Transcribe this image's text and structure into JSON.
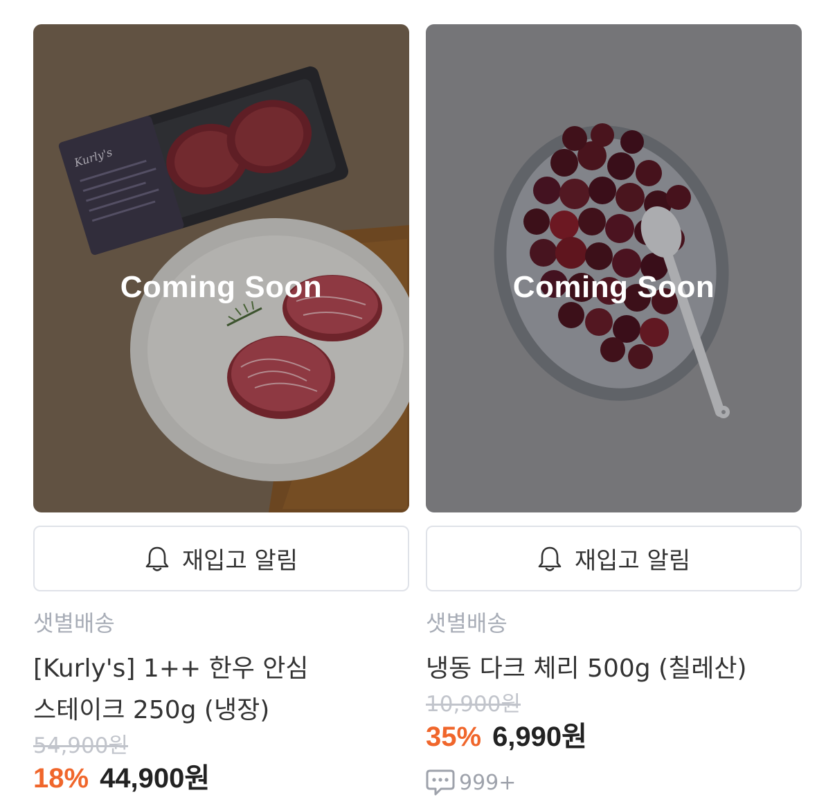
{
  "products": [
    {
      "overlay_text": "Coming Soon",
      "restock_label": "재입고 알림",
      "delivery": "샛별배송",
      "name": "[Kurly's] 1++ 한우 안심 스테이크 250g (냉장)",
      "original_price": "54,900원",
      "discount": "18%",
      "price": "44,900원"
    },
    {
      "overlay_text": "Coming Soon",
      "restock_label": "재입고 알림",
      "delivery": "샛별배송",
      "name": "냉동 다크 체리 500g (칠레산)",
      "original_price": "10,900원",
      "discount": "35%",
      "price": "6,990원",
      "review_count": "999+"
    }
  ],
  "colors": {
    "discount": "#f0662b",
    "price": "#222222",
    "muted": "#a8adb7",
    "border": "#dfe2e8"
  },
  "icons": {
    "restock": "bell-icon",
    "reviews": "speech-bubble-icon"
  }
}
